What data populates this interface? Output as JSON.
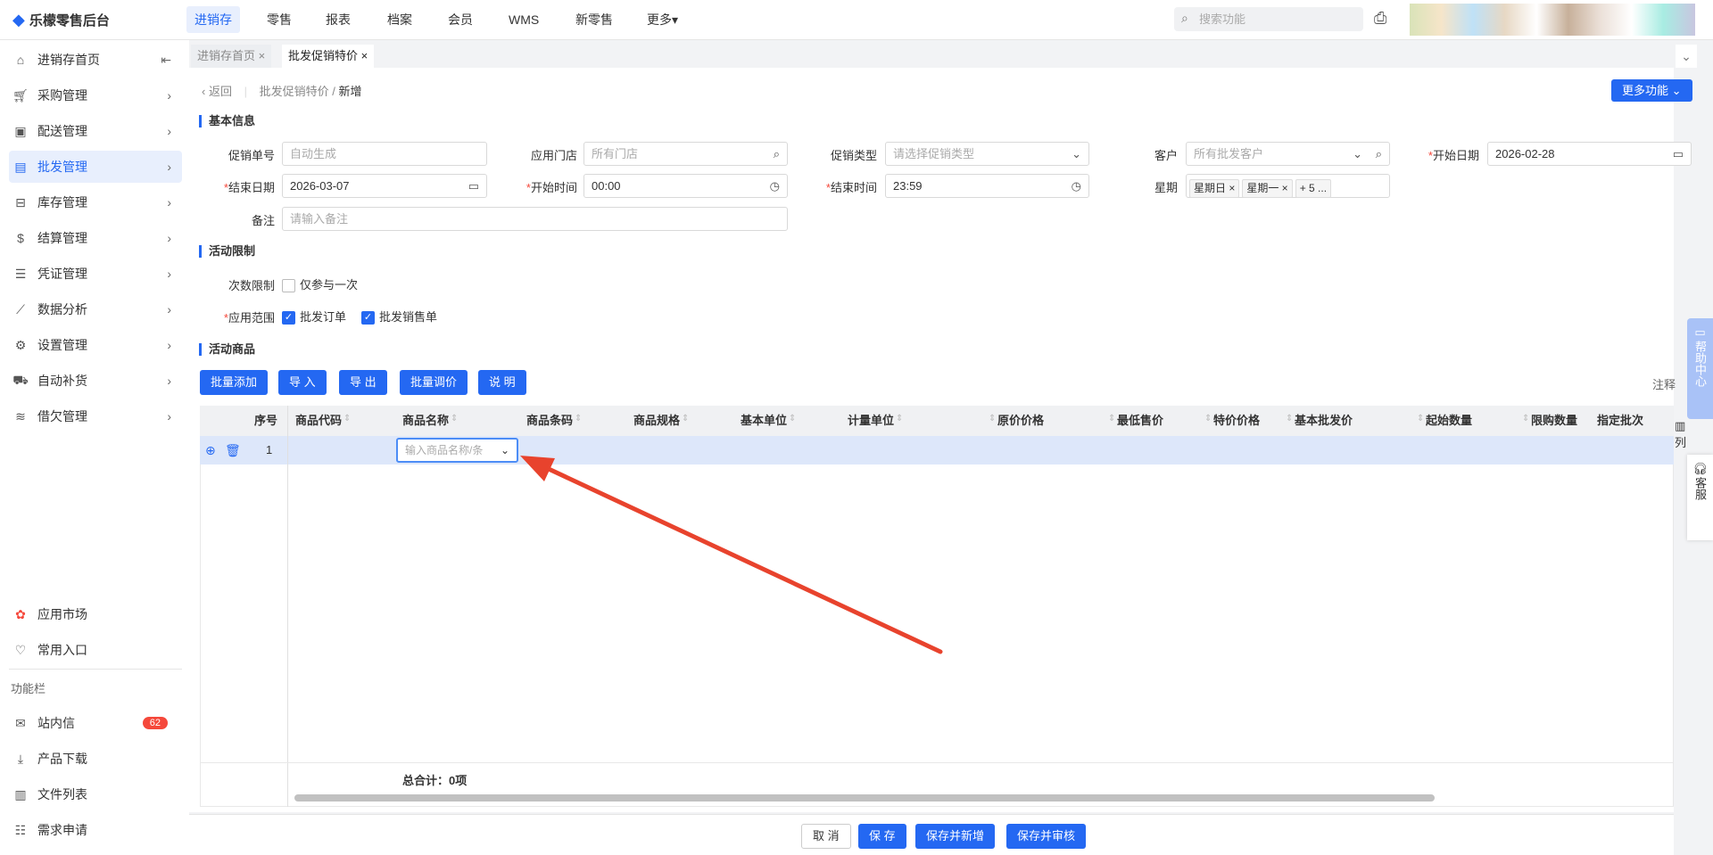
{
  "app": {
    "title": "乐檬零售后台",
    "search_placeholder": "搜索功能"
  },
  "topnav": [
    "进销存",
    "零售",
    "报表",
    "档案",
    "会员",
    "WMS",
    "新零售",
    "更多▾"
  ],
  "sidebar": {
    "items": [
      "进销存首页",
      "采购管理",
      "配送管理",
      "批发管理",
      "库存管理",
      "结算管理",
      "凭证管理",
      "数据分析",
      "设置管理",
      "自动补货",
      "借欠管理"
    ],
    "bottom": [
      "应用市场",
      "常用入口"
    ],
    "section": "功能栏",
    "tools": [
      "站内信",
      "产品下载",
      "文件列表",
      "需求申请"
    ],
    "unread": "62"
  },
  "tabs": [
    {
      "label": "进销存首页 ×"
    },
    {
      "label": "批发促销特价 ×"
    }
  ],
  "breadcrumb": {
    "back": "返回",
    "parent": "批发促销特价",
    "sep": "/",
    "current": "新增"
  },
  "more_button": "更多功能 ⌄",
  "basic": {
    "title": "基本信息",
    "promo_no": {
      "label": "促销单号",
      "placeholder": "自动生成"
    },
    "store": {
      "label": "应用门店",
      "placeholder": "所有门店"
    },
    "type": {
      "label": "促销类型",
      "placeholder": "请选择促销类型"
    },
    "customer": {
      "label": "客户",
      "placeholder": "所有批发客户"
    },
    "start_date": {
      "label": "开始日期",
      "value": "2026-02-28"
    },
    "end_date": {
      "label": "结束日期",
      "value": "2026-03-07"
    },
    "start_time": {
      "label": "开始时间",
      "value": "00:00"
    },
    "end_time": {
      "label": "结束时间",
      "value": "23:59"
    },
    "week": {
      "label": "星期",
      "tags": [
        "星期日 ×",
        "星期一 ×",
        "+ 5 ..."
      ]
    },
    "remark": {
      "label": "备注",
      "placeholder": "请输入备注"
    }
  },
  "limits": {
    "title": "活动限制",
    "count_label": "次数限制",
    "count_option": "仅参与一次",
    "scope_label": "应用范围",
    "scope_options": [
      "批发订单",
      "批发销售单"
    ]
  },
  "goods": {
    "title": "活动商品",
    "buttons": [
      "批量添加",
      "导 入",
      "导 出",
      "批量调价",
      "说 明"
    ],
    "note": "注释",
    "columns": [
      "序号",
      "商品代码",
      "商品名称",
      "商品条码",
      "商品规格",
      "基本单位",
      "计量单位",
      "原价价格",
      "最低售价",
      "特价价格",
      "基本批发价",
      "起始数量",
      "限购数量",
      "指定批次"
    ],
    "row": {
      "index": "1",
      "name_placeholder": "输入商品名称/条"
    },
    "total": "总合计：0项",
    "col_setting": "列"
  },
  "help": {
    "center": "帮助中心",
    "service": "客服"
  },
  "footer": {
    "buttons": [
      "取 消",
      "保 存",
      "保存并新增",
      "保存并审核"
    ]
  }
}
